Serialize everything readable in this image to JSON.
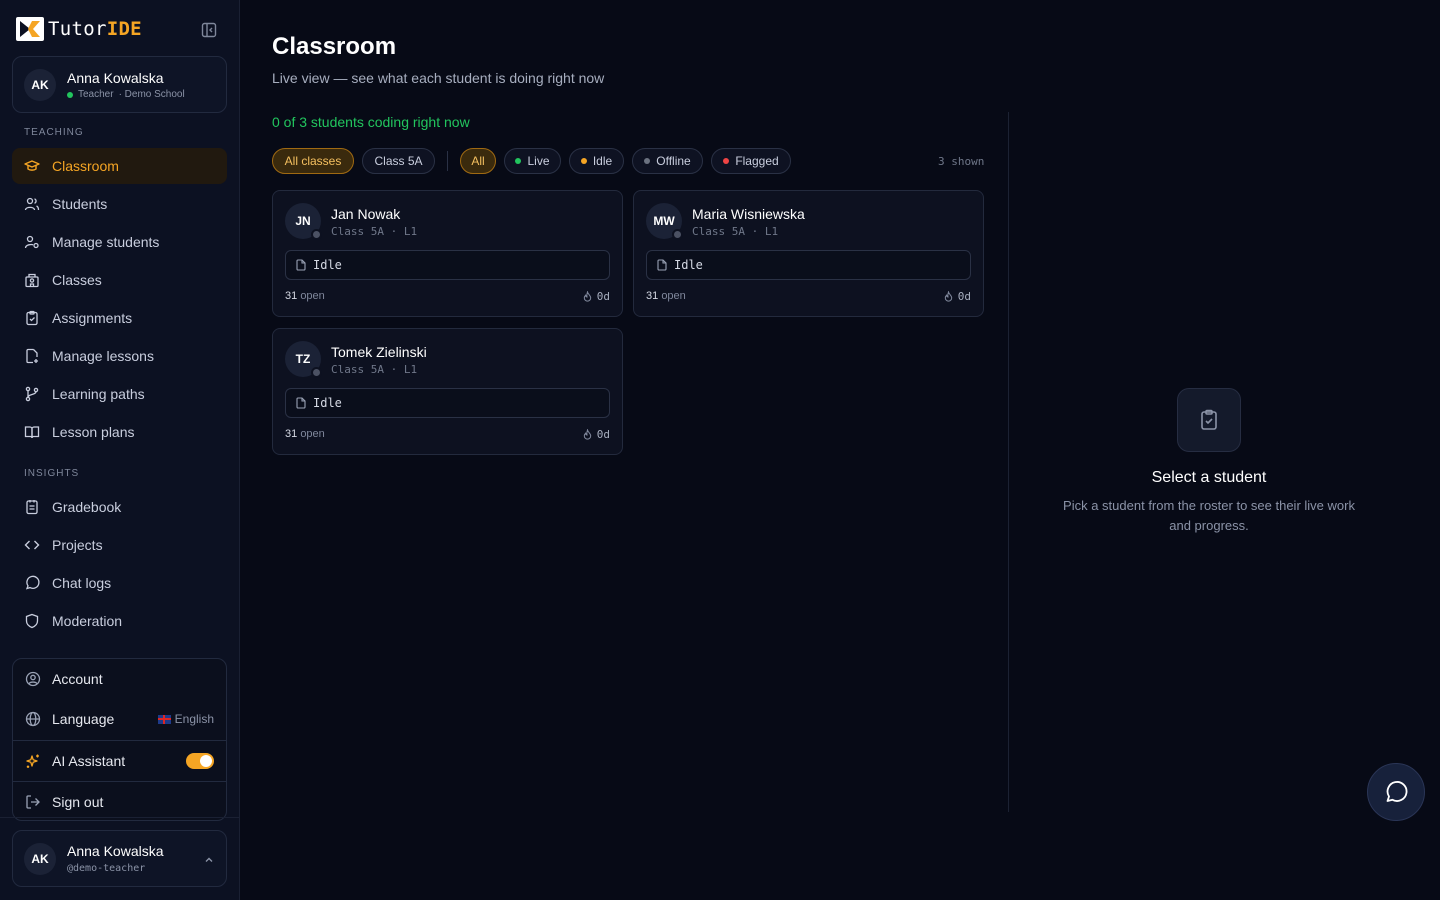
{
  "brand": {
    "part1": "Tutor",
    "part2": "IDE"
  },
  "user": {
    "initials": "AK",
    "name": "Anna Kowalska",
    "role": "Teacher",
    "school": "· Demo School",
    "handle": "@demo-teacher"
  },
  "sidebar": {
    "teaching_label": "TEACHING",
    "insights_label": "INSIGHTS",
    "teaching": [
      {
        "label": "Classroom",
        "icon": "graduation-cap-icon"
      },
      {
        "label": "Students",
        "icon": "users-icon"
      },
      {
        "label": "Manage students",
        "icon": "user-cog-icon"
      },
      {
        "label": "Classes",
        "icon": "school-icon"
      },
      {
        "label": "Assignments",
        "icon": "clipboard-icon"
      },
      {
        "label": "Manage lessons",
        "icon": "file-plus-icon"
      },
      {
        "label": "Learning paths",
        "icon": "git-branch-icon"
      },
      {
        "label": "Lesson plans",
        "icon": "book-open-icon"
      }
    ],
    "insights": [
      {
        "label": "Gradebook",
        "icon": "notebook-icon"
      },
      {
        "label": "Projects",
        "icon": "code-icon"
      },
      {
        "label": "Chat logs",
        "icon": "message-circle-icon"
      },
      {
        "label": "Moderation",
        "icon": "shield-icon"
      }
    ]
  },
  "menu": {
    "account": "Account",
    "language": "Language",
    "language_value": "English",
    "ai_assistant": "AI Assistant",
    "ai_enabled": true,
    "sign_out": "Sign out"
  },
  "page": {
    "title": "Classroom",
    "subtitle": "Live view — see what each student is doing right now",
    "status": "0 of 3 students coding right now",
    "shown": "3 shown"
  },
  "filters": {
    "classes": [
      {
        "label": "All classes",
        "active": true
      },
      {
        "label": "Class 5A",
        "active": false
      }
    ],
    "states": [
      {
        "label": "All",
        "active": true
      },
      {
        "label": "Live",
        "dot": "#22c55e"
      },
      {
        "label": "Idle",
        "dot": "#f5a524"
      },
      {
        "label": "Offline",
        "dot": "#6b7280"
      },
      {
        "label": "Flagged",
        "dot": "#ef4444"
      }
    ]
  },
  "students": [
    {
      "initials": "JN",
      "name": "Jan Nowak",
      "meta": "Class 5A · L1",
      "status": "Idle",
      "open_count": "31",
      "open_label": "open",
      "streak": "0d"
    },
    {
      "initials": "MW",
      "name": "Maria Wisniewska",
      "meta": "Class 5A · L1",
      "status": "Idle",
      "open_count": "31",
      "open_label": "open",
      "streak": "0d"
    },
    {
      "initials": "TZ",
      "name": "Tomek Zielinski",
      "meta": "Class 5A · L1",
      "status": "Idle",
      "open_count": "31",
      "open_label": "open",
      "streak": "0d"
    }
  ],
  "detail": {
    "empty_title": "Select a student",
    "empty_desc": "Pick a student from the roster to see their live work and progress."
  },
  "colors": {
    "accent": "#f5a524",
    "live": "#22c55e",
    "background": "#070a16",
    "sidebar": "#0c1122"
  }
}
